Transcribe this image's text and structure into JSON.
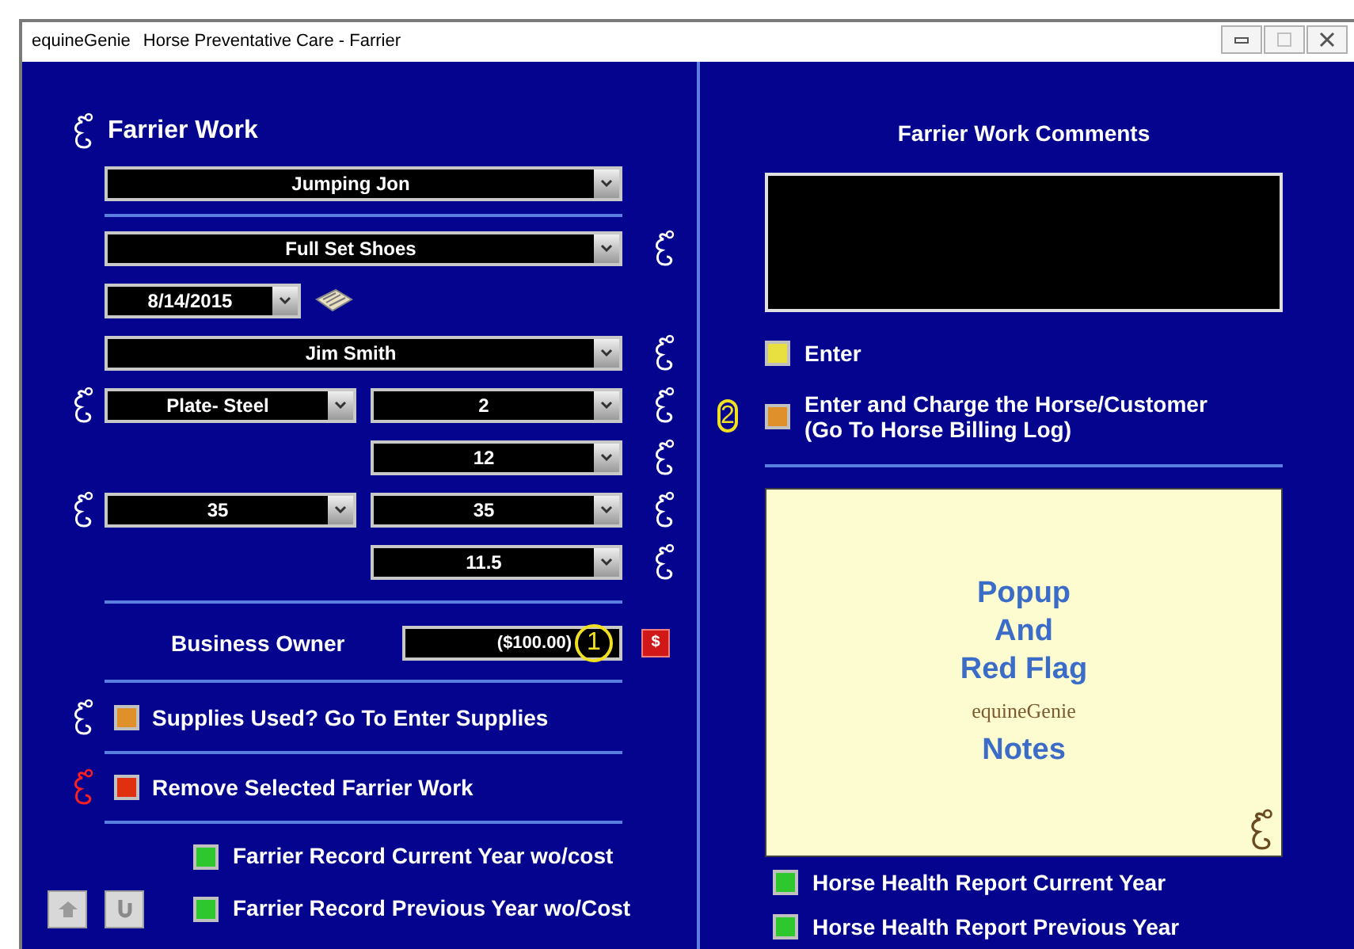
{
  "window": {
    "app_name": "equineGenie",
    "title": "Horse Preventative Care - Farrier",
    "controls": [
      {
        "kind": "minimize",
        "disabled": false
      },
      {
        "kind": "maximize",
        "disabled": true
      },
      {
        "kind": "close",
        "disabled": false
      }
    ]
  },
  "farrier_work": {
    "heading": "Farrier Work",
    "rows": [
      {
        "kind": "wide",
        "value": "Jumping Jon",
        "help": false
      },
      {
        "kind": "wide",
        "value": "Full Set Shoes",
        "help": true
      },
      {
        "kind": "date",
        "value": "8/14/2015"
      },
      {
        "kind": "wide",
        "value": "Jim Smith",
        "help": true
      },
      {
        "kind": "split",
        "left": {
          "value": "Plate- Steel",
          "help": true
        },
        "right": {
          "value": "2",
          "help": true
        }
      },
      {
        "kind": "split",
        "right": {
          "value": "12",
          "help": true
        }
      },
      {
        "kind": "split",
        "left": {
          "value": "35",
          "help": true
        },
        "right": {
          "value": "35",
          "help": true
        }
      },
      {
        "kind": "split",
        "right": {
          "value": "11.5",
          "help": true
        }
      }
    ]
  },
  "business_owner": {
    "label": "Business Owner",
    "amount": "($100.00)",
    "callout": "1",
    "button": "$"
  },
  "actions": [
    {
      "label": "Supplies Used? Go To Enter Supplies",
      "color": "#e0902a",
      "help": true,
      "danger": false
    },
    {
      "label": "Remove Selected Farrier Work",
      "color": "#e0300f",
      "help": true,
      "danger": true
    }
  ],
  "farrier_reports": [
    {
      "label": "Farrier Record Current Year wo/cost",
      "color": "#2ec82e"
    },
    {
      "label": "Farrier Record Previous Year wo/Cost",
      "color": "#2ec82e"
    }
  ],
  "comments": {
    "heading": "Farrier Work Comments"
  },
  "enter_buttons": [
    {
      "label_lines": [
        "Enter"
      ],
      "color": "#e8e040"
    },
    {
      "label_lines": [
        "Enter and Charge the Horse/Customer",
        "(Go To Horse Billing Log)"
      ],
      "color": "#e0902a",
      "callout": "2"
    }
  ],
  "notes": {
    "lines": [
      "Popup",
      "And",
      "Red Flag"
    ],
    "logo": "equineGenie",
    "footer": "Notes"
  },
  "health_reports": [
    {
      "label": "Horse Health Report Current Year",
      "color": "#2ec82e"
    },
    {
      "label": "Horse Health Report Previous Year",
      "color": "#2ec82e"
    }
  ]
}
